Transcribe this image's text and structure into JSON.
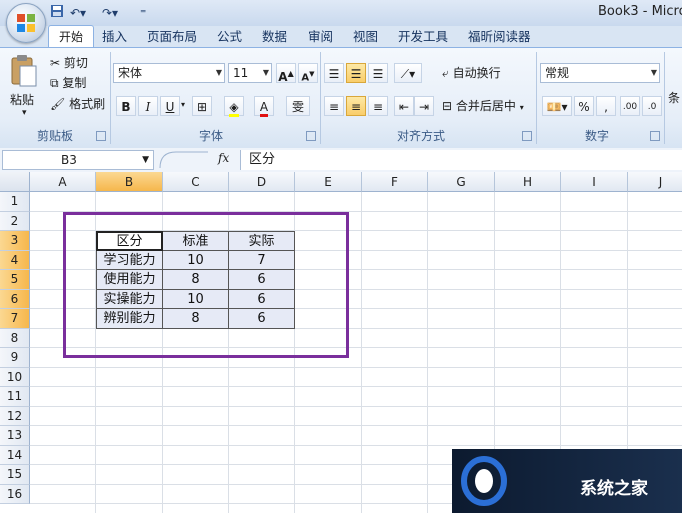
{
  "title_bar": {
    "document_title": "Book3 - Micro"
  },
  "tabs": [
    "开始",
    "插入",
    "页面布局",
    "公式",
    "数据",
    "审阅",
    "视图",
    "开发工具",
    "福昕阅读器"
  ],
  "ribbon": {
    "clipboard": {
      "paste": "粘贴",
      "cut": "剪切",
      "copy": "复制",
      "format_painter": "格式刷",
      "label": "剪贴板"
    },
    "font": {
      "font_name": "宋体",
      "font_size": "11",
      "bold": "B",
      "italic": "I",
      "underline": "U",
      "label": "字体"
    },
    "alignment": {
      "wrap_text": "自动换行",
      "merge_center": "合并后居中",
      "label": "对齐方式"
    },
    "number": {
      "format": "常规",
      "percent": "%",
      "comma": ",",
      "label": "数字"
    },
    "styles_partial": "条"
  },
  "formula_bar": {
    "name_box": "B3",
    "fx": "fx",
    "formula": "区分"
  },
  "columns": [
    "A",
    "B",
    "C",
    "D",
    "E",
    "F",
    "G",
    "H",
    "I",
    "J"
  ],
  "rows": [
    "1",
    "2",
    "3",
    "4",
    "5",
    "6",
    "7",
    "8",
    "9",
    "10",
    "11",
    "12",
    "13",
    "14",
    "15",
    "16"
  ],
  "table": {
    "header": [
      "区分",
      "标准",
      "实际"
    ],
    "rows": [
      [
        "学习能力",
        "10",
        "7"
      ],
      [
        "使用能力",
        "8",
        "6"
      ],
      [
        "实操能力",
        "10",
        "6"
      ],
      [
        "辨别能力",
        "8",
        "6"
      ]
    ]
  },
  "watermark": {
    "text": "系统之家"
  },
  "colors": {
    "annotation_border": "#7a2f9c",
    "active_header": "#f6b74c",
    "ribbon_blue": "#d9e5f3"
  }
}
